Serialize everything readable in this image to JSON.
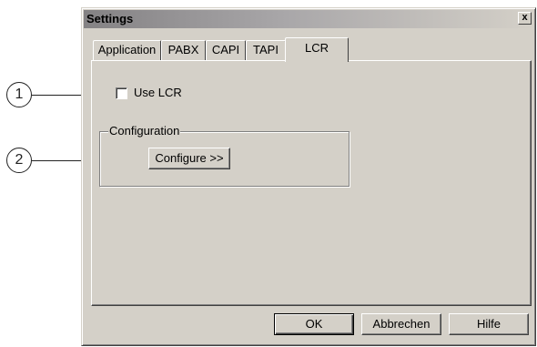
{
  "callouts": [
    "1",
    "2"
  ],
  "dialog": {
    "title": "Settings",
    "close_glyph": "x",
    "tabs": [
      {
        "label": "Application"
      },
      {
        "label": "PABX"
      },
      {
        "label": "CAPI"
      },
      {
        "label": "TAPI"
      },
      {
        "label": "LCR",
        "active": true
      }
    ],
    "use_lcr": {
      "label": "Use LCR",
      "checked": false
    },
    "configuration": {
      "legend": "Configuration",
      "button_label": "Configure >>"
    },
    "footer": {
      "ok_label": "OK",
      "cancel_label": "Abbrechen",
      "help_label": "Hilfe"
    }
  }
}
